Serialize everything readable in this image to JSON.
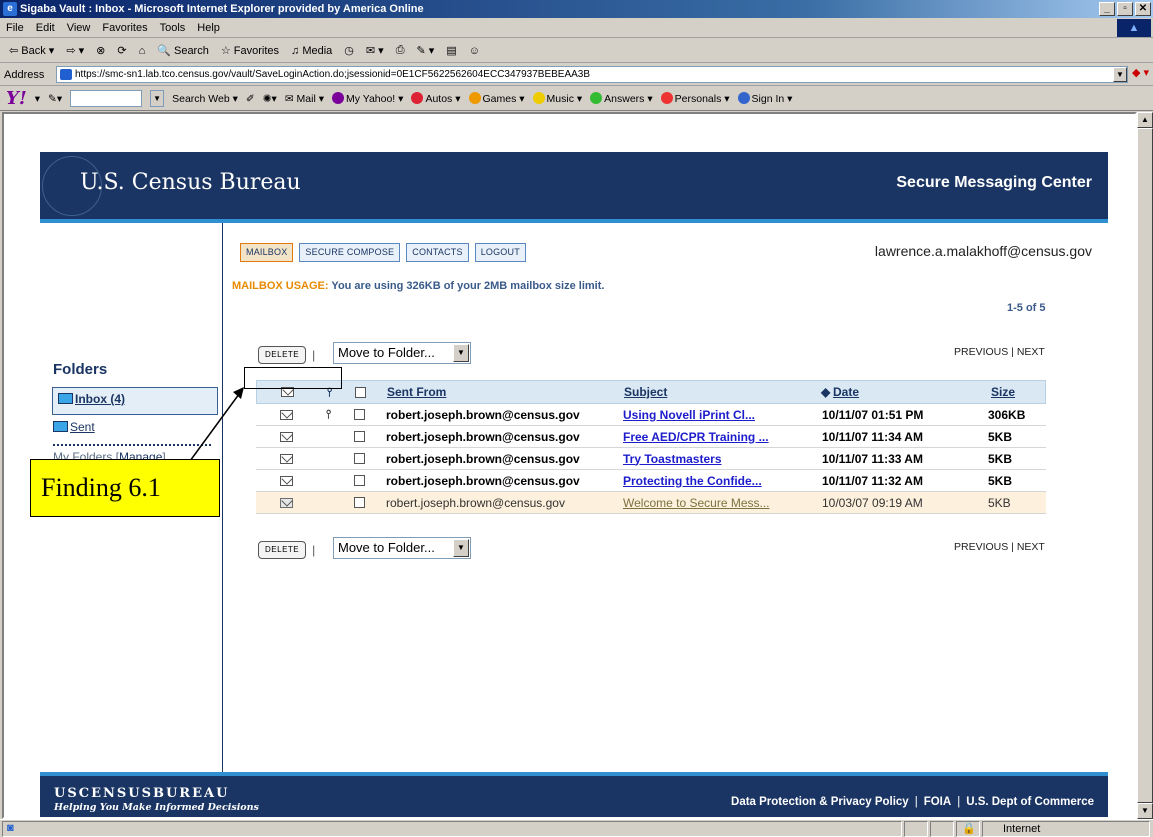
{
  "window": {
    "title": "Sigaba Vault : Inbox - Microsoft Internet Explorer provided by America Online",
    "menu": [
      "File",
      "Edit",
      "View",
      "Favorites",
      "Tools",
      "Help"
    ],
    "toolbar": {
      "back": "Back",
      "search": "Search",
      "favorites": "Favorites",
      "media": "Media"
    },
    "address_label": "Address",
    "address_url": "https://smc-sn1.lab.tco.census.gov/vault/SaveLoginAction.do;jsessionid=0E1CF5622562604ECC347937BEBEAA3B",
    "yahoo": {
      "search_web": "Search Web",
      "items": [
        "Mail",
        "My Yahoo!",
        "Autos",
        "Games",
        "Music",
        "Answers",
        "Personals",
        "Sign In"
      ]
    },
    "status_zone": "Internet"
  },
  "header": {
    "brand": "U.S. Census Bureau",
    "title": "Secure Messaging Center"
  },
  "sidebar": {
    "heading": "Folders",
    "inbox": "Inbox (4)",
    "sent": "Sent",
    "my_folders": "My Folders [",
    "manage": "Manage",
    "close_bracket": "]"
  },
  "tabs": [
    "MAILBOX",
    "SECURE COMPOSE",
    "CONTACTS",
    "LOGOUT"
  ],
  "user_email": "lawrence.a.malakhoff@census.gov",
  "usage": {
    "label": "MAILBOX USAGE:",
    "text": "You are using 326KB of your 2MB mailbox size limit."
  },
  "paging": {
    "count": "1-5 of 5",
    "prevnext": "PREVIOUS | NEXT"
  },
  "actions": {
    "delete": "DELETE",
    "move": "Move to Folder..."
  },
  "table": {
    "headers": {
      "from": "Sent From",
      "subject": "Subject",
      "date": "Date",
      "size": "Size"
    },
    "rows": [
      {
        "from": "robert.joseph.brown@census.gov",
        "subject": "Using Novell iPrint Cl...",
        "date": "10/11/07 01:51 PM",
        "size": "306KB",
        "attachment": true,
        "read": false
      },
      {
        "from": "robert.joseph.brown@census.gov",
        "subject": "Free AED/CPR Training ...",
        "date": "10/11/07 11:34 AM",
        "size": "5KB",
        "attachment": false,
        "read": false
      },
      {
        "from": "robert.joseph.brown@census.gov",
        "subject": "Try Toastmasters",
        "date": "10/11/07 11:33 AM",
        "size": "5KB",
        "attachment": false,
        "read": false
      },
      {
        "from": "robert.joseph.brown@census.gov",
        "subject": "Protecting the Confide...",
        "date": "10/11/07 11:32 AM",
        "size": "5KB",
        "attachment": false,
        "read": false
      },
      {
        "from": "robert.joseph.brown@census.gov",
        "subject": "Welcome to Secure Mess...",
        "date": "10/03/07 09:19 AM",
        "size": "5KB",
        "attachment": false,
        "read": true
      }
    ]
  },
  "footer": {
    "logo": "USCENSUSBUREAU",
    "tagline": "Helping You Make Informed Decisions",
    "link1": "Data Protection & Privacy Policy",
    "link2": "FOIA",
    "link3": "U.S. Dept of Commerce"
  },
  "annotation": {
    "label": "Finding 6.1"
  }
}
